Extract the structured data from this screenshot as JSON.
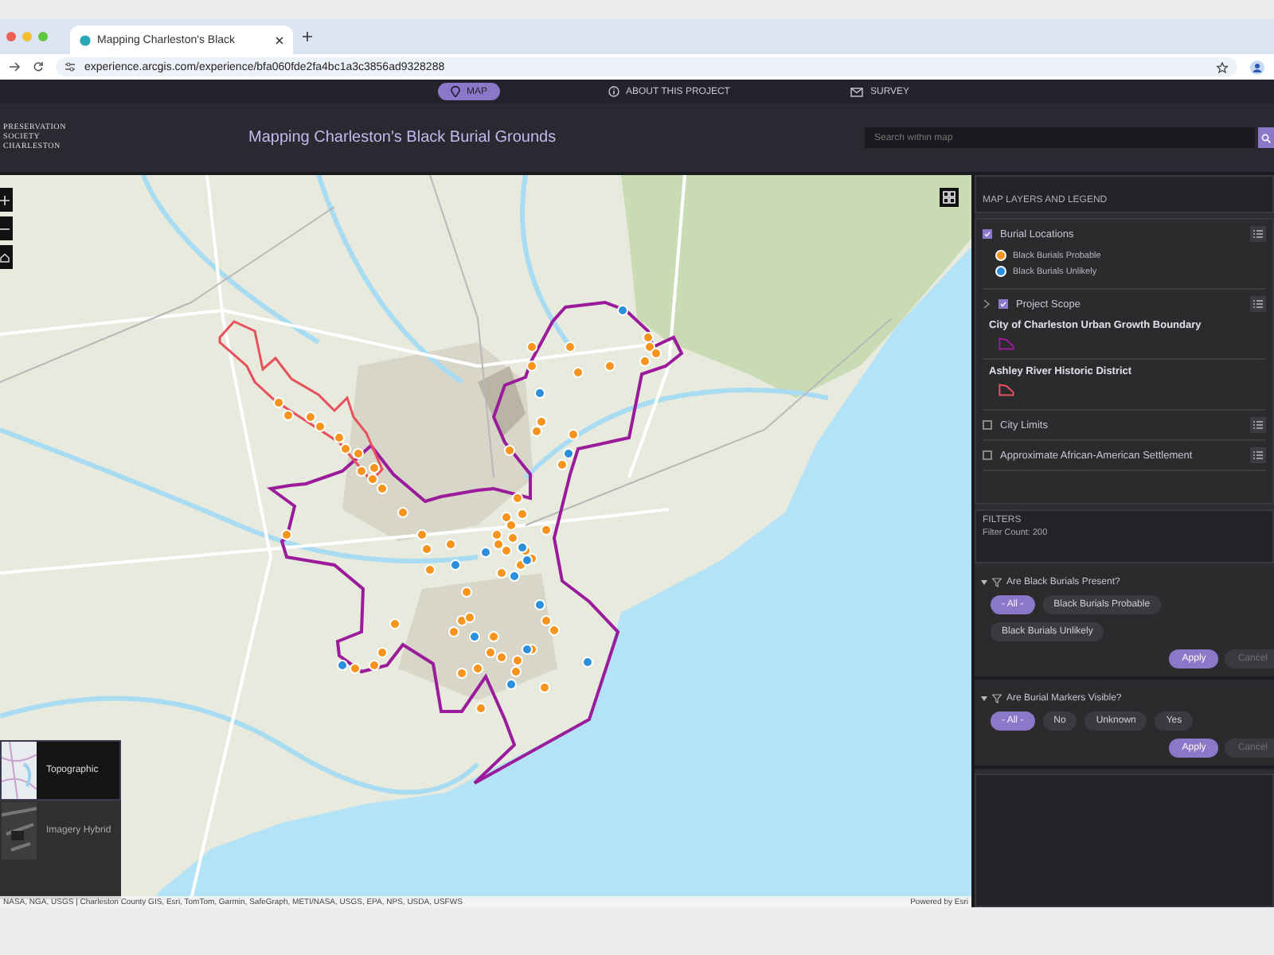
{
  "browser": {
    "tab_title": "Mapping Charleston's Black",
    "url": "experience.arcgis.com/experience/bfa060fde2fa4bc1a3c3856ad9328288"
  },
  "nav": [
    {
      "label": "MAP",
      "selected": true
    },
    {
      "label": "ABOUT THIS PROJECT",
      "selected": false
    },
    {
      "label": "SURVEY",
      "selected": false
    }
  ],
  "header": {
    "logo_lines": [
      "PRESERVATION",
      "SOCIETY",
      "CHARLESTON"
    ],
    "title": "Mapping Charleston's Black Burial Grounds",
    "search": {
      "placeholder": "Search within map"
    }
  },
  "map": {
    "attribution": "NASA, NGA, USGS | Charleston County GIS, Esri, TomTom, Garmin, SafeGraph, METI/NASA, USGS, EPA, NPS, USDA, USFWS",
    "powered_by": "Powered by Esri",
    "basemaps": [
      {
        "label": "Topographic",
        "selected": true
      },
      {
        "label": "Imagery Hybrid",
        "selected": false
      }
    ]
  },
  "layers": {
    "title": "MAP LAYERS AND LEGEND",
    "items": [
      {
        "name": "Burial Locations",
        "checked": true,
        "expandable": false,
        "legend": [
          {
            "label": "Black Burials Probable",
            "color": "#f7941d"
          },
          {
            "label": "Black Burials Unlikely",
            "color": "#2b8fdc"
          }
        ]
      },
      {
        "name": "Project Scope",
        "checked": true,
        "expandable": true,
        "sublayers": [
          {
            "name": "City of Charleston Urban Growth Boundary",
            "color": "#9b1c9b"
          },
          {
            "name": "Ashley River Historic District",
            "color": "#e8505b"
          }
        ]
      },
      {
        "name": "City Limits",
        "checked": false,
        "expandable": false
      },
      {
        "name": "Approximate African-American Settlement",
        "checked": false,
        "expandable": false
      }
    ]
  },
  "filters": {
    "title": "FILTERS",
    "count": "Filter Count: 200",
    "groups": [
      {
        "question": "Are Black Burials Present?",
        "options": [
          {
            "label": "- All -",
            "selected": true
          },
          {
            "label": "Black Burials Probable",
            "selected": false
          },
          {
            "label": "Black Burials Unlikely",
            "selected": false
          }
        ],
        "buttons": [
          {
            "label": "Apply",
            "disabled": false
          },
          {
            "label": "Cancel",
            "disabled": true
          }
        ]
      },
      {
        "question": "Are Burial Markers Visible?",
        "options": [
          {
            "label": "- All -",
            "selected": true
          },
          {
            "label": "No",
            "selected": false
          },
          {
            "label": "Unknown",
            "selected": false
          },
          {
            "label": "Yes",
            "selected": false
          }
        ],
        "buttons": [
          {
            "label": "Apply",
            "disabled": false
          },
          {
            "label": "Cancel",
            "disabled": true
          }
        ]
      }
    ]
  }
}
